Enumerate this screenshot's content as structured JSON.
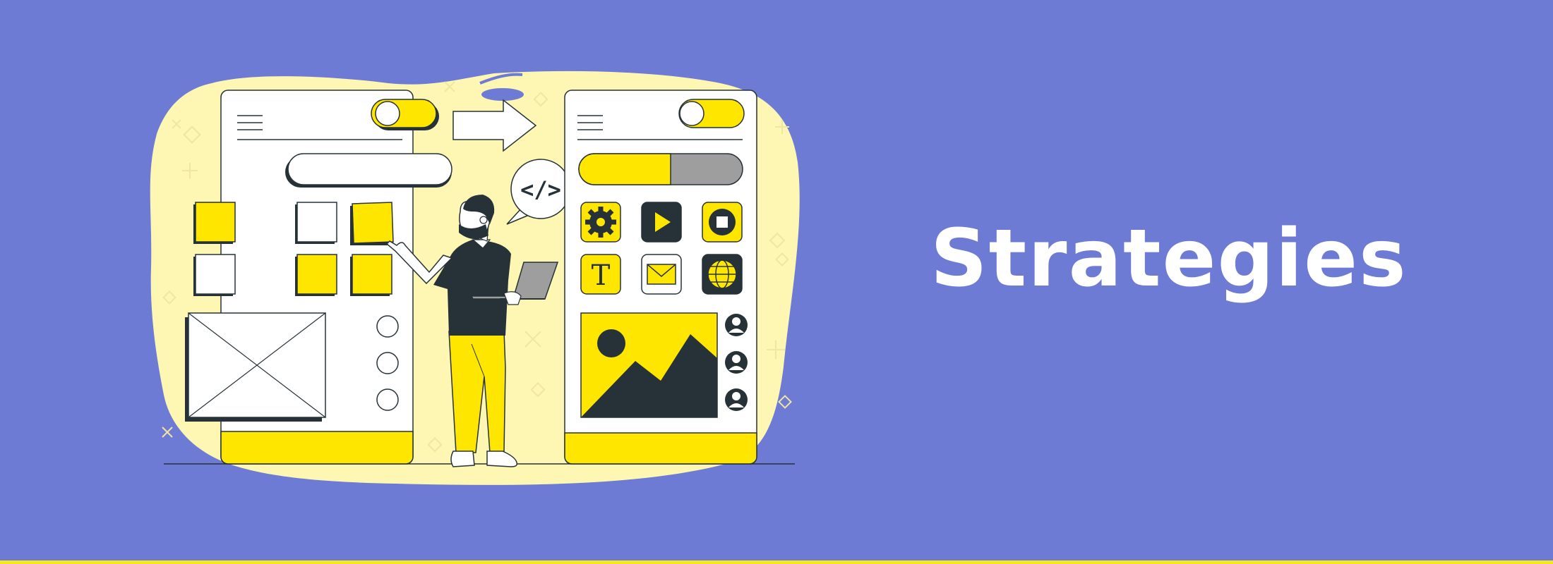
{
  "banner": {
    "title": "Strategies",
    "background_color": "#6e7bd4",
    "accent_color": "#ffe600",
    "dark_color": "#263238",
    "blob_color": "#fdf7b3",
    "stripe_color": "#f5e71f"
  },
  "illustration": {
    "code_bubble_text": "</>",
    "text_tile_glyph": "T",
    "icons": [
      "gear-icon",
      "play-icon",
      "stop-icon",
      "text-icon",
      "mail-icon",
      "globe-icon",
      "image-icon",
      "user-icon"
    ]
  }
}
